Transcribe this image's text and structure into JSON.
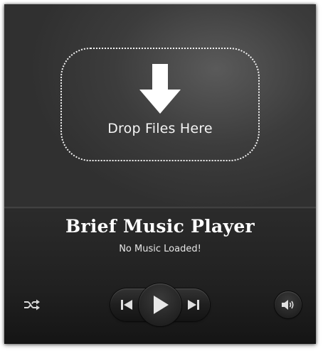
{
  "drop_zone": {
    "label": "Drop Files Here",
    "icon": "download-arrow-icon"
  },
  "player": {
    "title": "Brief Music Player",
    "status": "No Music Loaded!"
  },
  "controls": {
    "shuffle_icon": "shuffle-icon",
    "previous_icon": "skip-previous-icon",
    "play_icon": "play-icon",
    "next_icon": "skip-next-icon",
    "volume_icon": "volume-icon"
  },
  "colors": {
    "text": "#ffffff",
    "icon": "#d9d9d9",
    "background": "#2a2a2a"
  }
}
